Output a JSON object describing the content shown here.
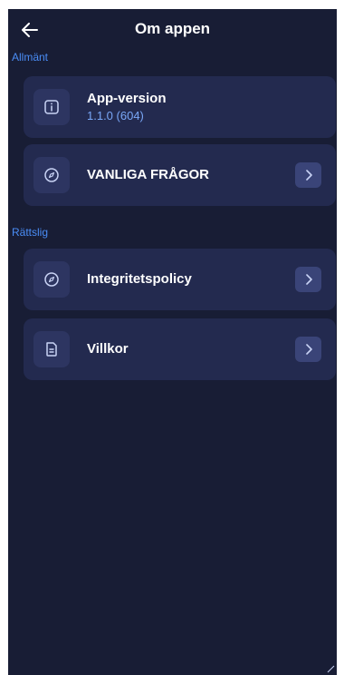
{
  "header": {
    "title": "Om appen",
    "back_icon": "arrow-left-icon"
  },
  "sections": {
    "general": {
      "label": "Allmänt"
    },
    "legal": {
      "label": "Rättslig"
    }
  },
  "items": {
    "app_version": {
      "title": "App-version",
      "subtitle": "1.1.0 (604)",
      "icon": "info-icon"
    },
    "faq": {
      "title": "VANLIGA FRÅGOR",
      "icon": "compass-icon"
    },
    "privacy": {
      "title": "Integritetspolicy",
      "icon": "compass-icon"
    },
    "terms": {
      "title": "Villkor",
      "icon": "document-icon"
    }
  },
  "colors": {
    "background": "#181d35",
    "card": "#232a4f",
    "icon_box": "#2d3561",
    "chevron_box": "#3a4478",
    "accent": "#4a8df6",
    "subtitle": "#79a7f7"
  }
}
